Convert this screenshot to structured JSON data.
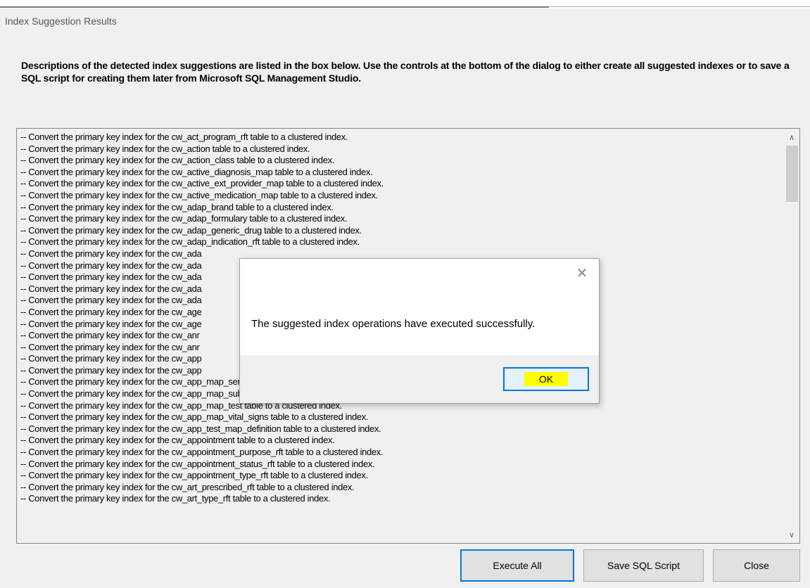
{
  "window": {
    "title": "Index Suggestion Results"
  },
  "description": "Descriptions of the detected index suggestions are listed in the box below. Use the controls at the bottom of the dialog to either create all suggested indexes or to save a SQL script for creating them later from Microsoft SQL Management Studio.",
  "list": {
    "items": [
      "-- Convert the primary key index for the cw_act_program_rft table to a clustered index.",
      "-- Convert the primary key index for the cw_action table to a clustered index.",
      "-- Convert the primary key index for the cw_action_class table to a clustered index.",
      "-- Convert the primary key index for the cw_active_diagnosis_map table to a clustered index.",
      "-- Convert the primary key index for the cw_active_ext_provider_map table to a clustered index.",
      "-- Convert the primary key index for the cw_active_medication_map table to a clustered index.",
      "-- Convert the primary key index for the cw_adap_brand table to a clustered index.",
      "-- Convert the primary key index for the cw_adap_formulary table to a clustered index.",
      "-- Convert the primary key index for the cw_adap_generic_drug table to a clustered index.",
      "-- Convert the primary key index for the cw_adap_indication_rft table to a clustered index.",
      "-- Convert the primary key index for the cw_ada",
      "-- Convert the primary key index for the cw_ada",
      "-- Convert the primary key index for the cw_ada",
      "-- Convert the primary key index for the cw_ada",
      "-- Convert the primary key index for the cw_ada",
      "-- Convert the primary key index for the cw_age",
      "-- Convert the primary key index for the cw_age",
      "-- Convert the primary key index for the cw_anr",
      "-- Convert the primary key index for the cw_anr",
      "-- Convert the primary key index for the cw_app",
      "-- Convert the primary key index for the cw_app",
      "-- Convert the primary key index for the cw_app_map_service table to a clustered index.",
      "-- Convert the primary key index for the cw_app_map_subservice table to a clustered index.",
      "-- Convert the primary key index for the cw_app_map_test table to a clustered index.",
      "-- Convert the primary key index for the cw_app_map_vital_signs table to a clustered index.",
      "-- Convert the primary key index for the cw_app_test_map_definition table to a clustered index.",
      "-- Convert the primary key index for the cw_appointment table to a clustered index.",
      "-- Convert the primary key index for the cw_appointment_purpose_rft table to a clustered index.",
      "-- Convert the primary key index for the cw_appointment_status_rft table to a clustered index.",
      "-- Convert the primary key index for the cw_appointment_type_rft table to a clustered index.",
      "-- Convert the primary key index for the cw_art_prescribed_rft table to a clustered index.",
      "-- Convert the primary key index for the cw_art_type_rft table to a clustered index."
    ]
  },
  "buttons": {
    "execute_all": "Execute All",
    "save_sql_script": "Save SQL Script",
    "close": "Close"
  },
  "message_box": {
    "text": "The suggested index operations have executed successfully.",
    "ok_label": "OK",
    "highlight_color": "#ffff00"
  },
  "icons": {
    "close": "close-icon",
    "scroll_up": "chevron-up-icon",
    "scroll_down": "chevron-down-icon"
  }
}
